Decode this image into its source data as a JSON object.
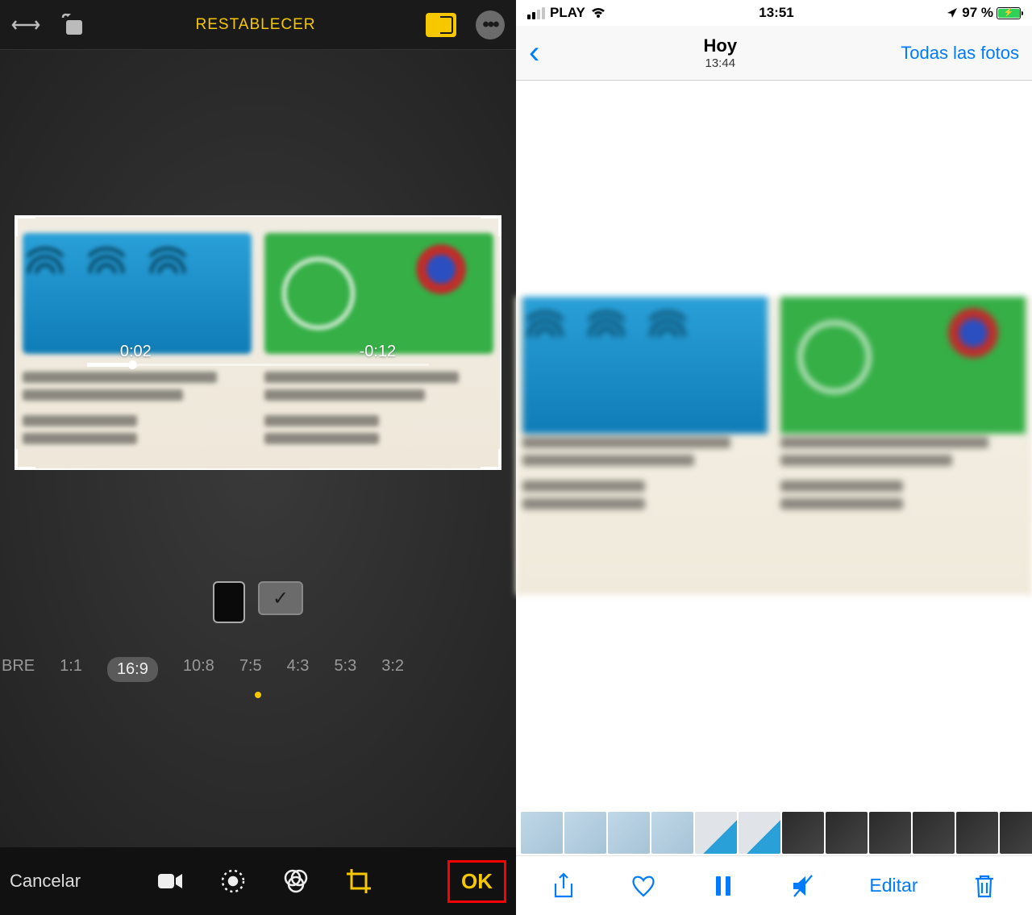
{
  "left": {
    "reset_label": "RESTABLECER",
    "time_elapsed": "0:02",
    "time_remaining": "-0:12",
    "ratios": [
      "BRE",
      "1:1",
      "16:9",
      "10:8",
      "7:5",
      "4:3",
      "5:3",
      "3:2"
    ],
    "selected_ratio": "16:9",
    "cancel_label": "Cancelar",
    "ok_label": "OK"
  },
  "right": {
    "status": {
      "carrier": "PLAY",
      "time": "13:51",
      "battery_pct": "97 %"
    },
    "nav": {
      "title": "Hoy",
      "subtitle": "13:44",
      "all_photos": "Todas las fotos"
    },
    "edit_label": "Editar"
  }
}
